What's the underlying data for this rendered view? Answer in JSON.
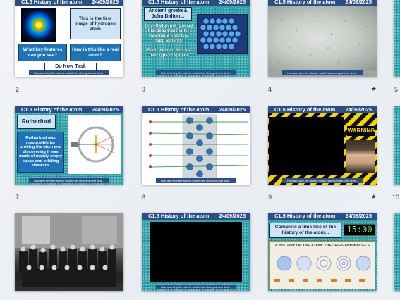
{
  "slide_header": {
    "title": "C1.5 History of the atom",
    "date": "24/09/2025"
  },
  "slide_footer": "How and why the atomic model has changed over time...",
  "slide_numbers": [
    "2",
    "3",
    "4",
    "5",
    "7",
    "8",
    "9",
    "10"
  ],
  "star_glyph": "⁝★",
  "slides": {
    "s2": {
      "text1": "This is the first image of hydrogen atom",
      "q1": "What key features can you see?",
      "q2": "How is this like a real atom?",
      "task": "Do Now Task"
    },
    "s3": {
      "title": "Ancient greeks& John Dalton...",
      "body": "John Dalton put forward his ideas that matter was made from tiny hard spheres\n\nEach element was its own type of sphere"
    },
    "s7": {
      "title": "Rutherford",
      "body": "Rutherford was responsible for probing the atom and discovering it was made of mainly empty space and orbiting electrons"
    },
    "s9": {
      "warning": "WARNING"
    },
    "s12": {
      "task": "Complete a time line of the history of the atom...",
      "timer": "15:00",
      "poster_title": "A HISTORY OF THE ATOM: THEORIES AND MODELS"
    }
  },
  "colors": {
    "header": "#2a4f86",
    "teal": "#2ea5ad",
    "box": "#1f73b8",
    "timer": "#0f0"
  }
}
